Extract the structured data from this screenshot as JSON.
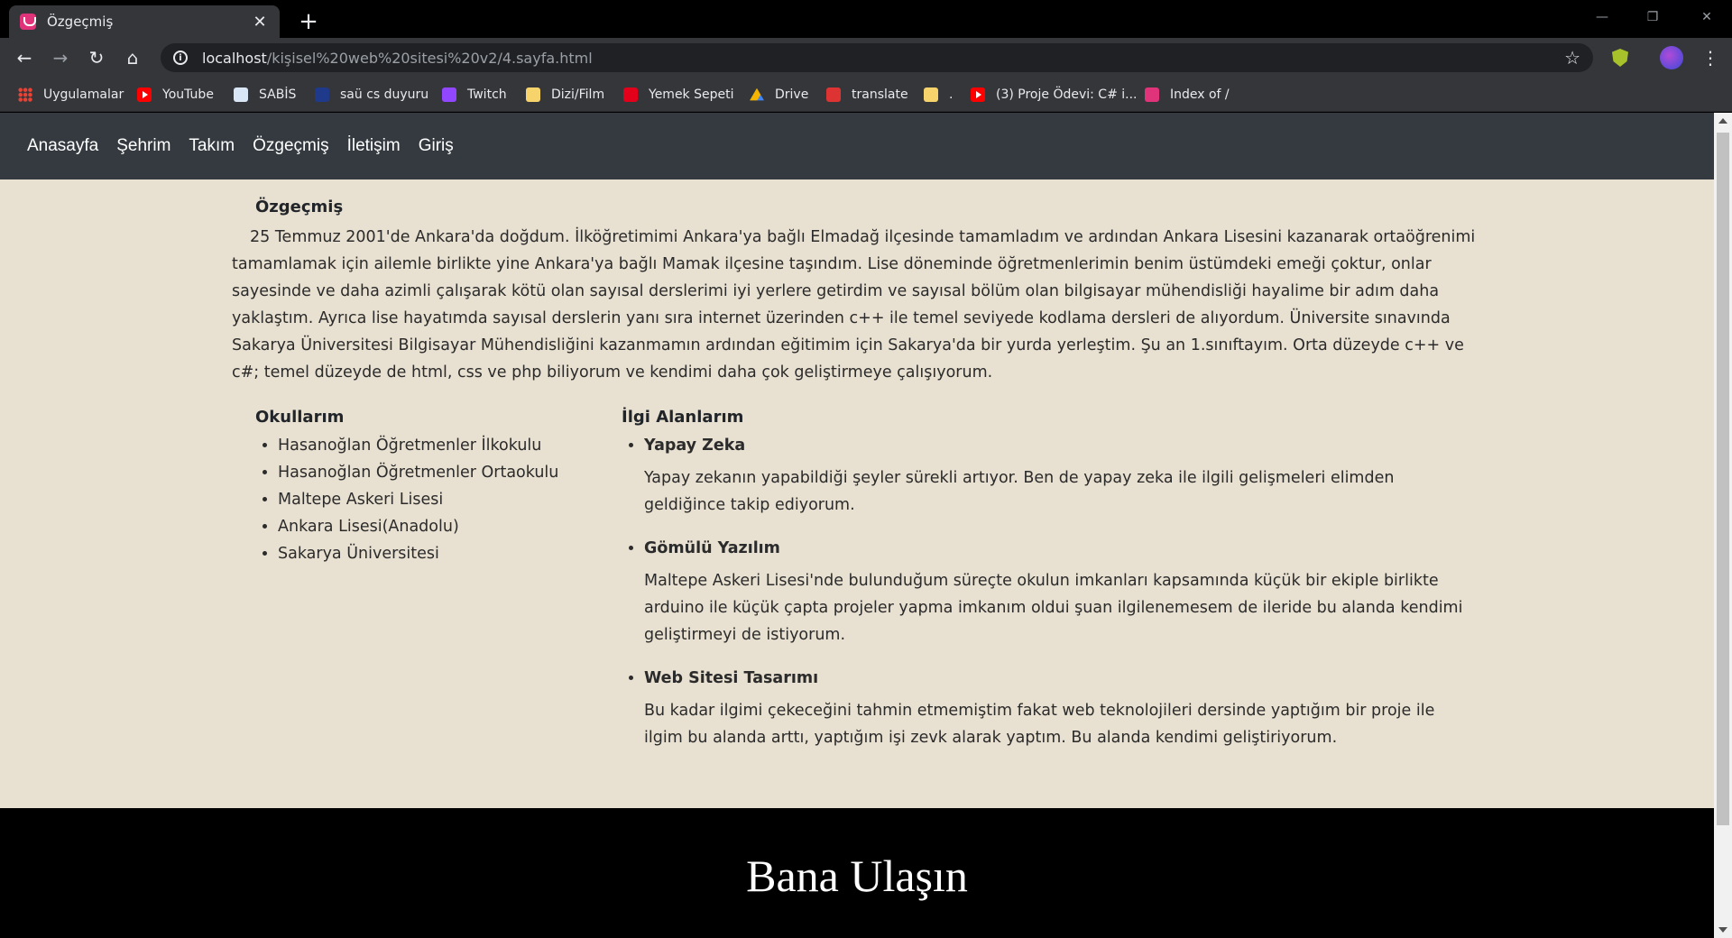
{
  "browser": {
    "tab_title": "Özgeçmiş",
    "url_host": "localhost",
    "url_path": "/kişisel%20web%20sitesi%20v2/4.sayfa.html",
    "bookmarks": [
      {
        "label": "Uygulamalar",
        "icon": "apps-grid-icon"
      },
      {
        "label": "YouTube",
        "icon": "youtube-icon"
      },
      {
        "label": "SABİS",
        "icon": "document-icon"
      },
      {
        "label": "saü cs duyuru",
        "icon": "sau-logo-icon"
      },
      {
        "label": "Twitch",
        "icon": "twitch-icon"
      },
      {
        "label": "Dizi/Film",
        "icon": "folder-icon"
      },
      {
        "label": "Yemek Sepeti",
        "icon": "yemeksepeti-icon"
      },
      {
        "label": "Drive",
        "icon": "drive-icon"
      },
      {
        "label": "translate",
        "icon": "translate-icon"
      },
      {
        "label": ".",
        "icon": "folder-icon"
      },
      {
        "label": "(3) Proje Ödevi: C# i...",
        "icon": "youtube-icon"
      },
      {
        "label": "Index of /",
        "icon": "index-icon"
      }
    ]
  },
  "nav": {
    "items": [
      "Anasayfa",
      "Şehrim",
      "Takım",
      "Özgeçmiş",
      "İletişim",
      "Giriş"
    ]
  },
  "bio": {
    "heading": "Özgeçmiş",
    "text": "25 Temmuz 2001'de Ankara'da doğdum. İlköğretimimi Ankara'ya bağlı Elmadağ ilçesinde tamamladım ve ardından Ankara Lisesini kazanarak ortaöğrenimi tamamlamak için ailemle birlikte yine Ankara'ya bağlı Mamak ilçesine taşındım. Lise döneminde öğretmenlerimin benim üstümdeki emeği çoktur, onlar sayesinde ve daha azimli çalışarak kötü olan sayısal derslerimi iyi yerlere getirdim ve sayısal bölüm olan bilgisayar mühendisliği hayalime bir adım daha yaklaştım. Ayrıca lise hayatımda sayısal derslerin yanı sıra internet üzerinden c++ ile temel seviyede kodlama dersleri de alıyordum. Üniversite sınavında Sakarya Üniversitesi Bilgisayar Mühendisliğini kazanmamın ardından eğitimim için Sakarya'da bir yurda yerleştim. Şu an 1.sınıftayım. Orta düzeyde c++ ve c#; temel düzeyde de html, css ve php biliyorum ve kendimi daha çok geliştirmeye çalışıyorum."
  },
  "schools": {
    "heading": "Okullarım",
    "items": [
      "Hasanoğlan Öğretmenler İlkokulu",
      "Hasanoğlan Öğretmenler Ortaokulu",
      "Maltepe Askeri Lisesi",
      "Ankara Lisesi(Anadolu)",
      "Sakarya Üniversitesi"
    ]
  },
  "interests": {
    "heading": "İlgi Alanlarım",
    "items": [
      {
        "title": "Yapay Zeka",
        "desc": "Yapay zekanın yapabildiği şeyler sürekli artıyor. Ben de yapay zeka ile ilgili gelişmeleri elimden geldiğince takip ediyorum."
      },
      {
        "title": "Gömülü Yazılım",
        "desc": "Maltepe Askeri Lisesi'nde bulunduğum süreçte okulun imkanları kapsamında küçük bir ekiple birlikte arduino ile küçük çapta projeler yapma imkanım oldui şuan ilgilenemesem de ileride bu alanda kendimi geliştirmeyi de istiyorum."
      },
      {
        "title": "Web Sitesi Tasarımı",
        "desc": "Bu kadar ilgimi çekeceğini tahmin etmemiştim fakat web teknolojileri dersinde yaptığım bir proje ile ilgim bu alanda arttı, yaptığım işi zevk alarak yaptım. Bu alanda kendimi geliştiriyorum."
      }
    ]
  },
  "footer": {
    "heading": "Bana Ulaşın"
  }
}
